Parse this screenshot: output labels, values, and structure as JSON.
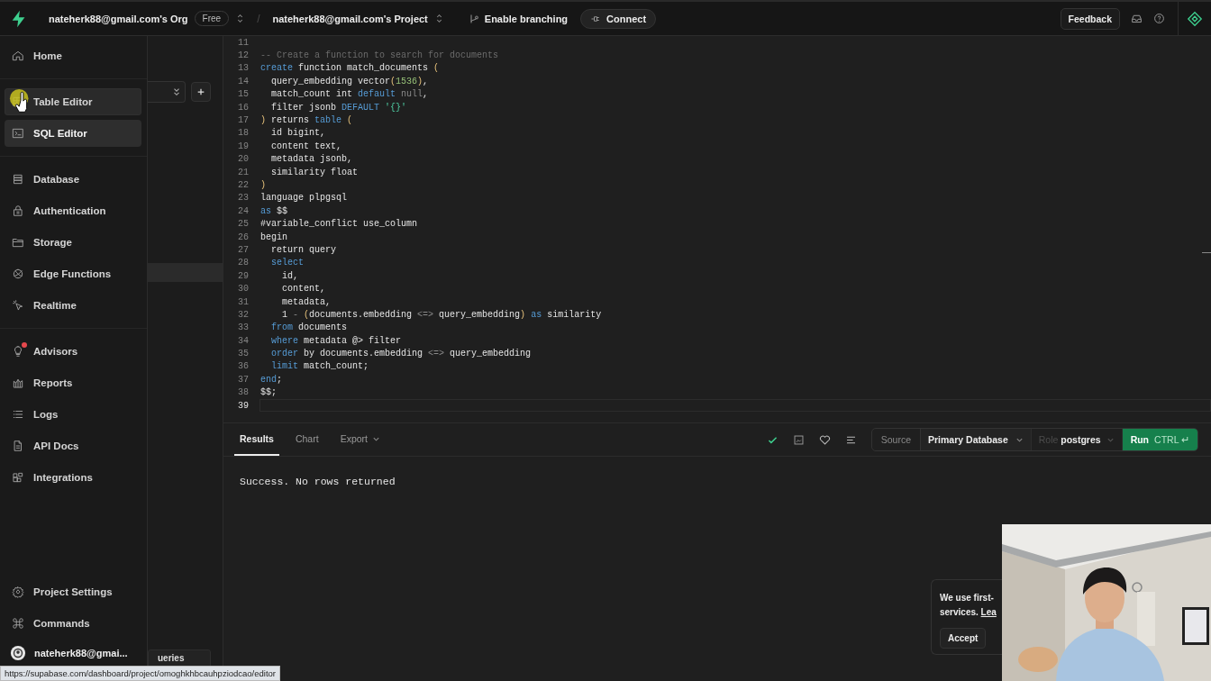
{
  "topbar": {
    "org": "nateherk88@gmail.com's Org",
    "plan": "Free",
    "separator": "/",
    "project": "nateherk88@gmail.com's Project",
    "branching": "Enable branching",
    "connect": "Connect",
    "feedback": "Feedback"
  },
  "sidebar": {
    "groups": [
      [
        {
          "label": "Home",
          "selected": false,
          "hovered": false,
          "alert": false
        }
      ],
      [
        {
          "label": "Table Editor",
          "selected": false,
          "hovered": true,
          "alert": false
        },
        {
          "label": "SQL Editor",
          "selected": true,
          "hovered": false,
          "alert": false
        }
      ],
      [
        {
          "label": "Database",
          "selected": false,
          "hovered": false,
          "alert": false
        },
        {
          "label": "Authentication",
          "selected": false,
          "hovered": false,
          "alert": false
        },
        {
          "label": "Storage",
          "selected": false,
          "hovered": false,
          "alert": false
        },
        {
          "label": "Edge Functions",
          "selected": false,
          "hovered": false,
          "alert": false
        },
        {
          "label": "Realtime",
          "selected": false,
          "hovered": false,
          "alert": false
        }
      ],
      [
        {
          "label": "Advisors",
          "selected": false,
          "hovered": false,
          "alert": true
        },
        {
          "label": "Reports",
          "selected": false,
          "hovered": false,
          "alert": false
        },
        {
          "label": "Logs",
          "selected": false,
          "hovered": false,
          "alert": false
        },
        {
          "label": "API Docs",
          "selected": false,
          "hovered": false,
          "alert": false
        },
        {
          "label": "Integrations",
          "selected": false,
          "hovered": false,
          "alert": false
        }
      ]
    ],
    "footer": [
      {
        "label": "Project Settings",
        "selected": false,
        "hovered": false,
        "alert": false
      },
      {
        "label": "Commands",
        "selected": false,
        "hovered": false,
        "alert": false
      }
    ],
    "user": "nateherk88@gmai..."
  },
  "explorer": {
    "bottom_tab": "ueries"
  },
  "editor": {
    "lines": [
      {
        "number": "11",
        "current": false
      },
      {
        "number": "12",
        "current": false,
        "tokens": [
          {
            "t": "-- Create a function to search for documents",
            "kind": "comment"
          }
        ]
      },
      {
        "number": "13",
        "current": false,
        "tokens": [
          {
            "t": "create",
            "kind": "kw"
          },
          {
            "t": " function match_documents ",
            "kind": "plain"
          },
          {
            "t": "(",
            "kind": "paren"
          }
        ]
      },
      {
        "number": "14",
        "current": false,
        "tokens": [
          {
            "t": "  query_embedding vector",
            "kind": "plain"
          },
          {
            "t": "(",
            "kind": "paren"
          },
          {
            "t": "1536",
            "kind": "num"
          },
          {
            "t": ")",
            "kind": "paren"
          },
          {
            "t": ",",
            "kind": "plain"
          }
        ]
      },
      {
        "number": "15",
        "current": false,
        "tokens": [
          {
            "t": "  match_count int ",
            "kind": "plain"
          },
          {
            "t": "default",
            "kind": "kw"
          },
          {
            "t": " null",
            "kind": "dim"
          },
          {
            "t": ",",
            "kind": "plain"
          }
        ]
      },
      {
        "number": "16",
        "current": false,
        "tokens": [
          {
            "t": "  filter jsonb ",
            "kind": "plain"
          },
          {
            "t": "DEFAULT",
            "kind": "kw"
          },
          {
            "t": " '{}'",
            "kind": "str"
          }
        ]
      },
      {
        "number": "17",
        "current": false,
        "tokens": [
          {
            "t": ")",
            "kind": "paren"
          },
          {
            "t": " returns ",
            "kind": "plain"
          },
          {
            "t": "table",
            "kind": "kw"
          },
          {
            "t": " (",
            "kind": "paren"
          }
        ]
      },
      {
        "number": "18",
        "current": false,
        "tokens": [
          {
            "t": "  id bigint,",
            "kind": "plain"
          }
        ]
      },
      {
        "number": "19",
        "current": false,
        "tokens": [
          {
            "t": "  content text,",
            "kind": "plain"
          }
        ]
      },
      {
        "number": "20",
        "current": false,
        "tokens": [
          {
            "t": "  metadata jsonb,",
            "kind": "plain"
          }
        ]
      },
      {
        "number": "21",
        "current": false,
        "tokens": [
          {
            "t": "  similarity float",
            "kind": "plain"
          }
        ]
      },
      {
        "number": "22",
        "current": false,
        "tokens": [
          {
            "t": ")",
            "kind": "paren"
          }
        ]
      },
      {
        "number": "23",
        "current": false,
        "tokens": [
          {
            "t": "language plpgsql",
            "kind": "plain"
          }
        ]
      },
      {
        "number": "24",
        "current": false,
        "tokens": [
          {
            "t": "as",
            "kind": "kw"
          },
          {
            "t": " $$",
            "kind": "plain"
          }
        ]
      },
      {
        "number": "25",
        "current": false,
        "tokens": [
          {
            "t": "#variable_conflict use_column",
            "kind": "plain"
          }
        ]
      },
      {
        "number": "26",
        "current": false,
        "tokens": [
          {
            "t": "begin",
            "kind": "plain"
          }
        ]
      },
      {
        "number": "27",
        "current": false,
        "tokens": [
          {
            "t": "  return query",
            "kind": "plain"
          }
        ]
      },
      {
        "number": "28",
        "current": false,
        "tokens": [
          {
            "t": "  select",
            "kind": "kw"
          }
        ]
      },
      {
        "number": "29",
        "current": false,
        "tokens": [
          {
            "t": "    id,",
            "kind": "plain"
          }
        ]
      },
      {
        "number": "30",
        "current": false,
        "tokens": [
          {
            "t": "    content,",
            "kind": "plain"
          }
        ]
      },
      {
        "number": "31",
        "current": false,
        "tokens": [
          {
            "t": "    metadata,",
            "kind": "plain"
          }
        ]
      },
      {
        "number": "32",
        "current": false,
        "tokens": [
          {
            "t": "    1 ",
            "kind": "plain"
          },
          {
            "t": "- ",
            "kind": "dim"
          },
          {
            "t": "(",
            "kind": "paren"
          },
          {
            "t": "documents.embedding ",
            "kind": "plain"
          },
          {
            "t": "<=>",
            "kind": "dim"
          },
          {
            "t": " query_embedding",
            "kind": "plain"
          },
          {
            "t": ")",
            "kind": "paren"
          },
          {
            "t": " as",
            "kind": "kw"
          },
          {
            "t": " similarity",
            "kind": "plain"
          }
        ]
      },
      {
        "number": "33",
        "current": false,
        "tokens": [
          {
            "t": "  from",
            "kind": "kw"
          },
          {
            "t": " documents",
            "kind": "plain"
          }
        ]
      },
      {
        "number": "34",
        "current": false,
        "tokens": [
          {
            "t": "  where",
            "kind": "kw"
          },
          {
            "t": " metadata @> filter",
            "kind": "plain"
          }
        ]
      },
      {
        "number": "35",
        "current": false,
        "tokens": [
          {
            "t": "  order",
            "kind": "kw"
          },
          {
            "t": " by documents.embedding ",
            "kind": "plain"
          },
          {
            "t": "<=>",
            "kind": "dim"
          },
          {
            "t": " query_embedding",
            "kind": "plain"
          }
        ]
      },
      {
        "number": "36",
        "current": false,
        "tokens": [
          {
            "t": "  limit",
            "kind": "kw"
          },
          {
            "t": " match_count;",
            "kind": "plain"
          }
        ]
      },
      {
        "number": "37",
        "current": false,
        "tokens": [
          {
            "t": "end",
            "kind": "kw"
          },
          {
            "t": ";",
            "kind": "plain"
          }
        ]
      },
      {
        "number": "38",
        "current": false,
        "tokens": [
          {
            "t": "$$;",
            "kind": "plain"
          }
        ]
      },
      {
        "number": "39",
        "current": true
      }
    ]
  },
  "results": {
    "tabs": [
      {
        "label": "Results",
        "selected": true,
        "dropdown": false
      },
      {
        "label": "Chart",
        "selected": false,
        "dropdown": false
      },
      {
        "label": "Export",
        "selected": false,
        "dropdown": true
      }
    ],
    "source_label": "Source",
    "database": "Primary Database",
    "role_label": "Role",
    "role": "postgres",
    "run": "Run",
    "shortcut": "CTRL",
    "enter_key": "↵",
    "message": "Success. No rows returned"
  },
  "cookie_notice": {
    "line_1": "We use first-",
    "line_2": "services.",
    "link": "Lea",
    "accept": "Accept"
  },
  "status_url": "https://supabase.com/dashboard/project/omoghkhbcauhpziodcao/editor"
}
